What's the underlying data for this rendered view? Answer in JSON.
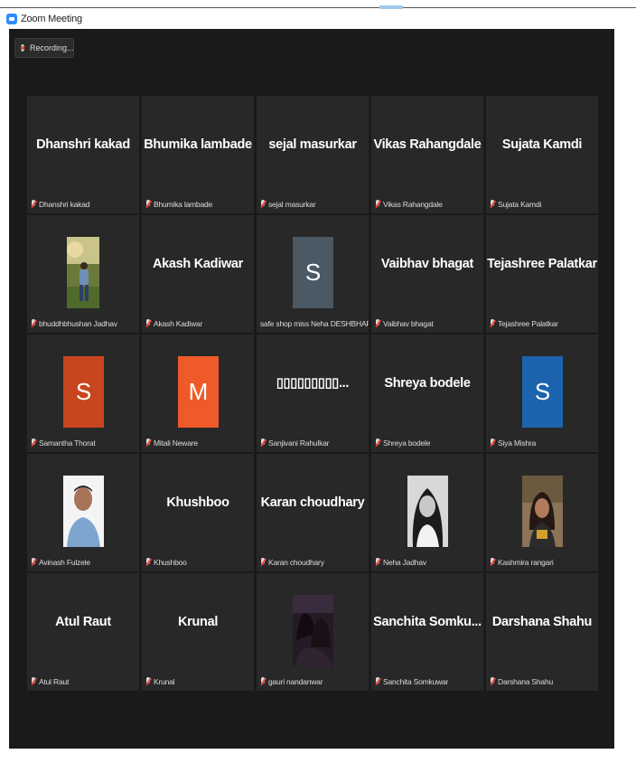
{
  "window": {
    "title": "Zoom Meeting"
  },
  "recording": {
    "label": "Recording..."
  },
  "participants": [
    {
      "display": "Dhanshri kakad",
      "label": "Dhanshri kakad"
    },
    {
      "display": "Bhumika lambade",
      "label": "Bhumika lambade"
    },
    {
      "display": "sejal masurkar",
      "label": "sejal masurkar"
    },
    {
      "display": "Vikas Rahangdale",
      "label": "Vikas Rahangdale"
    },
    {
      "display": "Sujata Kamdi",
      "label": "Sujata Kamdi"
    },
    {
      "photo": "portrait-outdoor-man",
      "label": "bhuddhbhushan Jadhav"
    },
    {
      "display": "Akash Kadiwar",
      "label": "Akash Kadiwar"
    },
    {
      "avatar_letter": "S",
      "avatar_color": "#4a5963",
      "label": "safe shop miss Neha DESHBHARTAR"
    },
    {
      "display": "Vaibhav bhagat",
      "label": "Vaibhav bhagat"
    },
    {
      "display": "Tejashree Palatkar",
      "label": "Tejashree Palatkar"
    },
    {
      "avatar_letter": "S",
      "avatar_color": "#c8461e",
      "label": "Samantha Thorat"
    },
    {
      "avatar_letter": "M",
      "avatar_color": "#ee5a29",
      "label": "Mitali Neware"
    },
    {
      "display": "▯▯▯▯▯▯▯▯▯...",
      "label": "Sanjivani Rahulkar"
    },
    {
      "display": "Shreya bodele",
      "label": "Shreya bodele"
    },
    {
      "avatar_letter": "S",
      "avatar_color": "#1c64ad",
      "label": "Siya Mishra"
    },
    {
      "photo": "portrait-man-white-shirt",
      "label": "Avinash Fulzele"
    },
    {
      "display": "Khushboo",
      "label": "Khushboo"
    },
    {
      "display": "Karan choudhary",
      "label": "Karan choudhary"
    },
    {
      "photo": "portrait-woman-bw",
      "label": "Neha Jadhav"
    },
    {
      "photo": "portrait-woman-color",
      "label": "Kashmira rangari"
    },
    {
      "display": "Atul Raut",
      "label": "Atul Raut"
    },
    {
      "display": "Krunal",
      "label": "Krunal"
    },
    {
      "photo": "portrait-two-women-dark",
      "label": "gauri nandanwar"
    },
    {
      "display": "Sanchita  Somku...",
      "label": "Sanchita Somkuwar"
    },
    {
      "display": "Darshana Shahu",
      "label": "Darshana Shahu"
    }
  ],
  "icons": {
    "muted": "mic-muted-icon",
    "app": "zoom-logo-icon"
  },
  "colors": {
    "window_bg": "#1a1a1a",
    "tile_bg": "#282828",
    "mute_red": "#e8413b"
  }
}
